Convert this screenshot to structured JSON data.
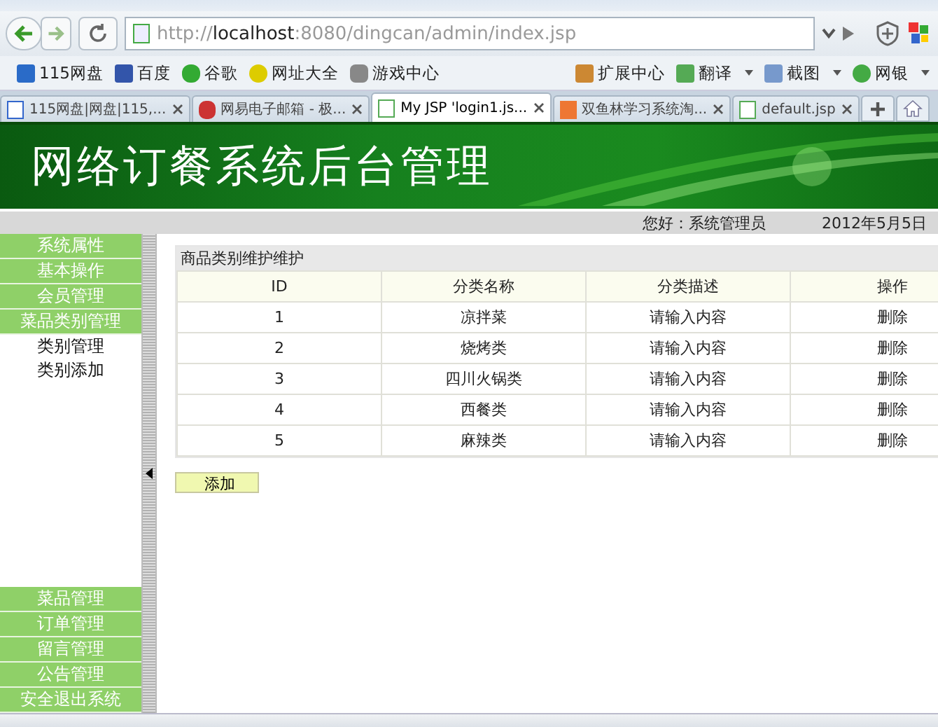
{
  "browser": {
    "address": "http://**localhost**:8080/dingcan/admin/index.jsp",
    "bookmarks_left": [
      "115网盘",
      "百度",
      "谷歌",
      "网址大全",
      "游戏中心"
    ],
    "bookmarks_right": [
      {
        "label": "扩展中心",
        "menu": false
      },
      {
        "label": "翻译",
        "menu": true
      },
      {
        "label": "截图",
        "menu": true
      },
      {
        "label": "网银",
        "menu": true
      }
    ],
    "tabs": [
      {
        "label": "115网盘|网盘|115,...",
        "selected": false
      },
      {
        "label": "网易电子邮箱 - 极...",
        "selected": false
      },
      {
        "label": "My JSP 'login1.js...",
        "selected": true
      },
      {
        "label": "双鱼林学习系统淘...",
        "selected": false
      },
      {
        "label": "default.jsp",
        "selected": false
      }
    ]
  },
  "banner": {
    "title": "网络订餐系统后台管理"
  },
  "header_bar": {
    "greeting": "您好：系统管理员",
    "date": "2012年5月5日"
  },
  "sidebar": {
    "top_items": [
      {
        "label": "系统属性"
      },
      {
        "label": "基本操作"
      },
      {
        "label": "会员管理"
      },
      {
        "label": "菜品类别管理",
        "children": [
          "类别管理",
          "类别添加"
        ]
      }
    ],
    "bottom_items": [
      {
        "label": "菜品管理"
      },
      {
        "label": "订单管理"
      },
      {
        "label": "留言管理"
      },
      {
        "label": "公告管理"
      },
      {
        "label": "安全退出系统"
      }
    ]
  },
  "panel": {
    "title": "商品类别维护维护",
    "columns": [
      "ID",
      "分类名称",
      "分类描述",
      "操作"
    ],
    "rows": [
      [
        "1",
        "凉拌菜",
        "请输入内容",
        "删除"
      ],
      [
        "2",
        "烧烤类",
        "请输入内容",
        "删除"
      ],
      [
        "3",
        "四川火锅类",
        "请输入内容",
        "删除"
      ],
      [
        "4",
        "西餐类",
        "请输入内容",
        "删除"
      ],
      [
        "5",
        "麻辣类",
        "请输入内容",
        "删除"
      ]
    ],
    "add_button": "添加"
  }
}
